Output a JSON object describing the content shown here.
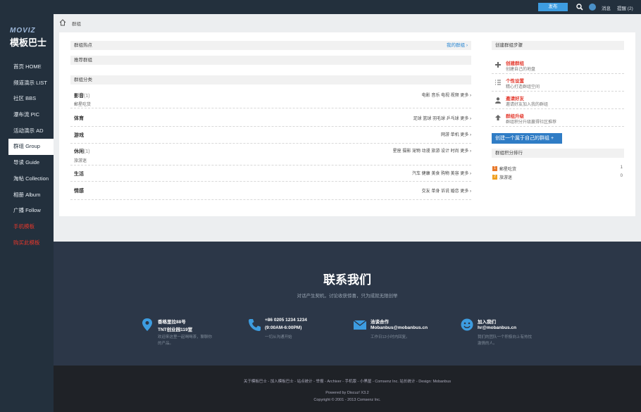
{
  "sidebar": {
    "logo_en": "MOVIZ",
    "logo_cn": "模板巴士",
    "items": [
      "首页 HOME",
      "频道演示 LIST",
      "社区 BBS",
      "瀑布流 PIC",
      "活动演示 AD",
      "群组 Group",
      "导读 Guide",
      "淘帖 Collection",
      "相册 Album",
      "广播 Follow",
      "手机模板",
      "购买此模板"
    ]
  },
  "topbar": {
    "publish": "发布",
    "messages": "消息",
    "remind": "提醒 (2)"
  },
  "breadcrumb": "群组",
  "main": {
    "hot": "群组热点",
    "my_groups": "我的群组 ›",
    "recommend": "推荐群组",
    "categories_title": "群组分类",
    "categories": [
      {
        "name": "影音",
        "count": "(1)",
        "sub": "郵星吃货",
        "links": "电影 音乐 电视 视频 更多 ›"
      },
      {
        "name": "体育",
        "count": "",
        "sub": "",
        "links": "足球 篮球 羽毛球 乒乓球 更多 ›"
      },
      {
        "name": "游戏",
        "count": "",
        "sub": "",
        "links": "网游 单机 更多 ›"
      },
      {
        "name": "休闲",
        "count": "(1)",
        "sub": "旅游迷",
        "links": "星座 摄影 宠物 动漫 旅游 设计 时尚 更多 ›"
      },
      {
        "name": "生活",
        "count": "",
        "sub": "",
        "links": "汽车 健康 美食 购物 美容 更多 ›"
      },
      {
        "name": "情感",
        "count": "",
        "sub": "",
        "links": "交友 单身 诉说 婚恋 更多 ›"
      }
    ],
    "steps_title": "创建群组步骤",
    "steps": [
      {
        "title": "创建群组",
        "desc": "创建自己的地盘"
      },
      {
        "title": "个性设置",
        "desc": "精心打造群组空间"
      },
      {
        "title": "邀请好友",
        "desc": "邀请好友加入我的群组"
      },
      {
        "title": "群组升级",
        "desc": "群组积分升级赢得社区推荐"
      }
    ],
    "create_button": "创建一个属于自己的群组 +",
    "rank_title": "群组积分排行",
    "ranks": [
      {
        "num": "1",
        "name": "郵星吃货",
        "value": "1"
      },
      {
        "num": "2",
        "name": "旅游迷",
        "value": "0"
      }
    ]
  },
  "contact": {
    "title": "联系我们",
    "subtitle": "对话产生契机，讨论收获惊喜，只为成就无限创举",
    "columns": [
      {
        "a": "香格里拉88号",
        "b": "TNT创业园119室",
        "c": "欢迎来这里一起喝喝茶，聊聊你的产品。"
      },
      {
        "a": "+86 0205 1234 1234",
        "b": "(9:00AM-6:00PM)",
        "c": "一切从沟通开始"
      },
      {
        "a": "洽谈合作",
        "b": "Mobanbus@mobanbus.cn",
        "c": "工作日12小时内回复。"
      },
      {
        "a": "加入我们",
        "b": "hr@mobanbus.cn",
        "c": "我们的团队一个积极向上有热忱激情的人。"
      }
    ]
  },
  "footer": {
    "links": "关于模板巴士 - 加入模板巴士 - 站点统计 - 举报 - Archiver - 手机版 - 小黑屋 - Comsenz Inc.  站长统计 - Design: Mobanbus",
    "powered": "Powered by Discuz! X3.2",
    "copyright": "Copyright © 2001 - 2013 Comsenz Inc."
  }
}
